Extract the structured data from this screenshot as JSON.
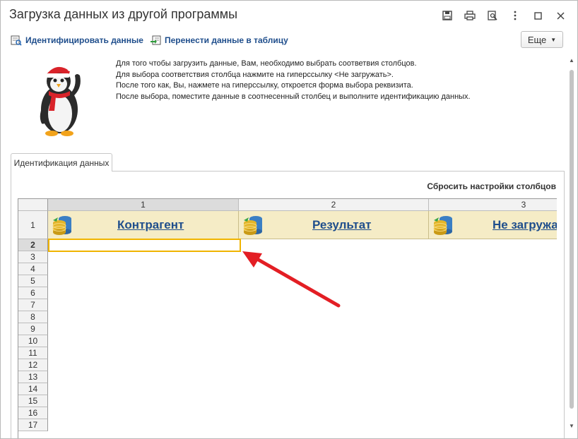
{
  "window": {
    "title": "Загрузка данных из другой программы",
    "buttons": [
      "save-icon",
      "print-icon",
      "preview-icon",
      "more-vert-icon",
      "maximize-icon",
      "close-icon"
    ]
  },
  "toolbar": {
    "identify_label": "Идентифицировать данные",
    "transfer_label": "Перенести данные в таблицу",
    "more_label": "Еще"
  },
  "instructions": [
    "Для того чтобы загрузить данные, Вам, необходимо выбрать соответвия столбцов.",
    "Для выбора соответствия столбца нажмите на гиперссылку <Не загружать>.",
    "После того как, Вы, нажмете на гиперссылку, откроется форма выбора реквизита.",
    "После выбора, поместите данные в соотнесенный столбец и выполните идентификацию данных."
  ],
  "tab": {
    "label": "Идентификация данных"
  },
  "grid": {
    "reset_label": "Сбросить настройки столбцов",
    "columns": [
      {
        "number": "1",
        "header": "Контрагент"
      },
      {
        "number": "2",
        "header": "Результат"
      },
      {
        "number": "3",
        "header": "Не загружать"
      }
    ],
    "rows": [
      "1",
      "2",
      "3",
      "4",
      "5",
      "6",
      "7",
      "8",
      "9",
      "10",
      "11",
      "12",
      "13",
      "14",
      "15",
      "16",
      "17"
    ],
    "active_row": "2",
    "active_col": "1"
  },
  "colors": {
    "link": "#1f4e8c",
    "header_fill": "#f5ecc6",
    "selection": "#f0b400",
    "arrow": "#e31e24"
  }
}
